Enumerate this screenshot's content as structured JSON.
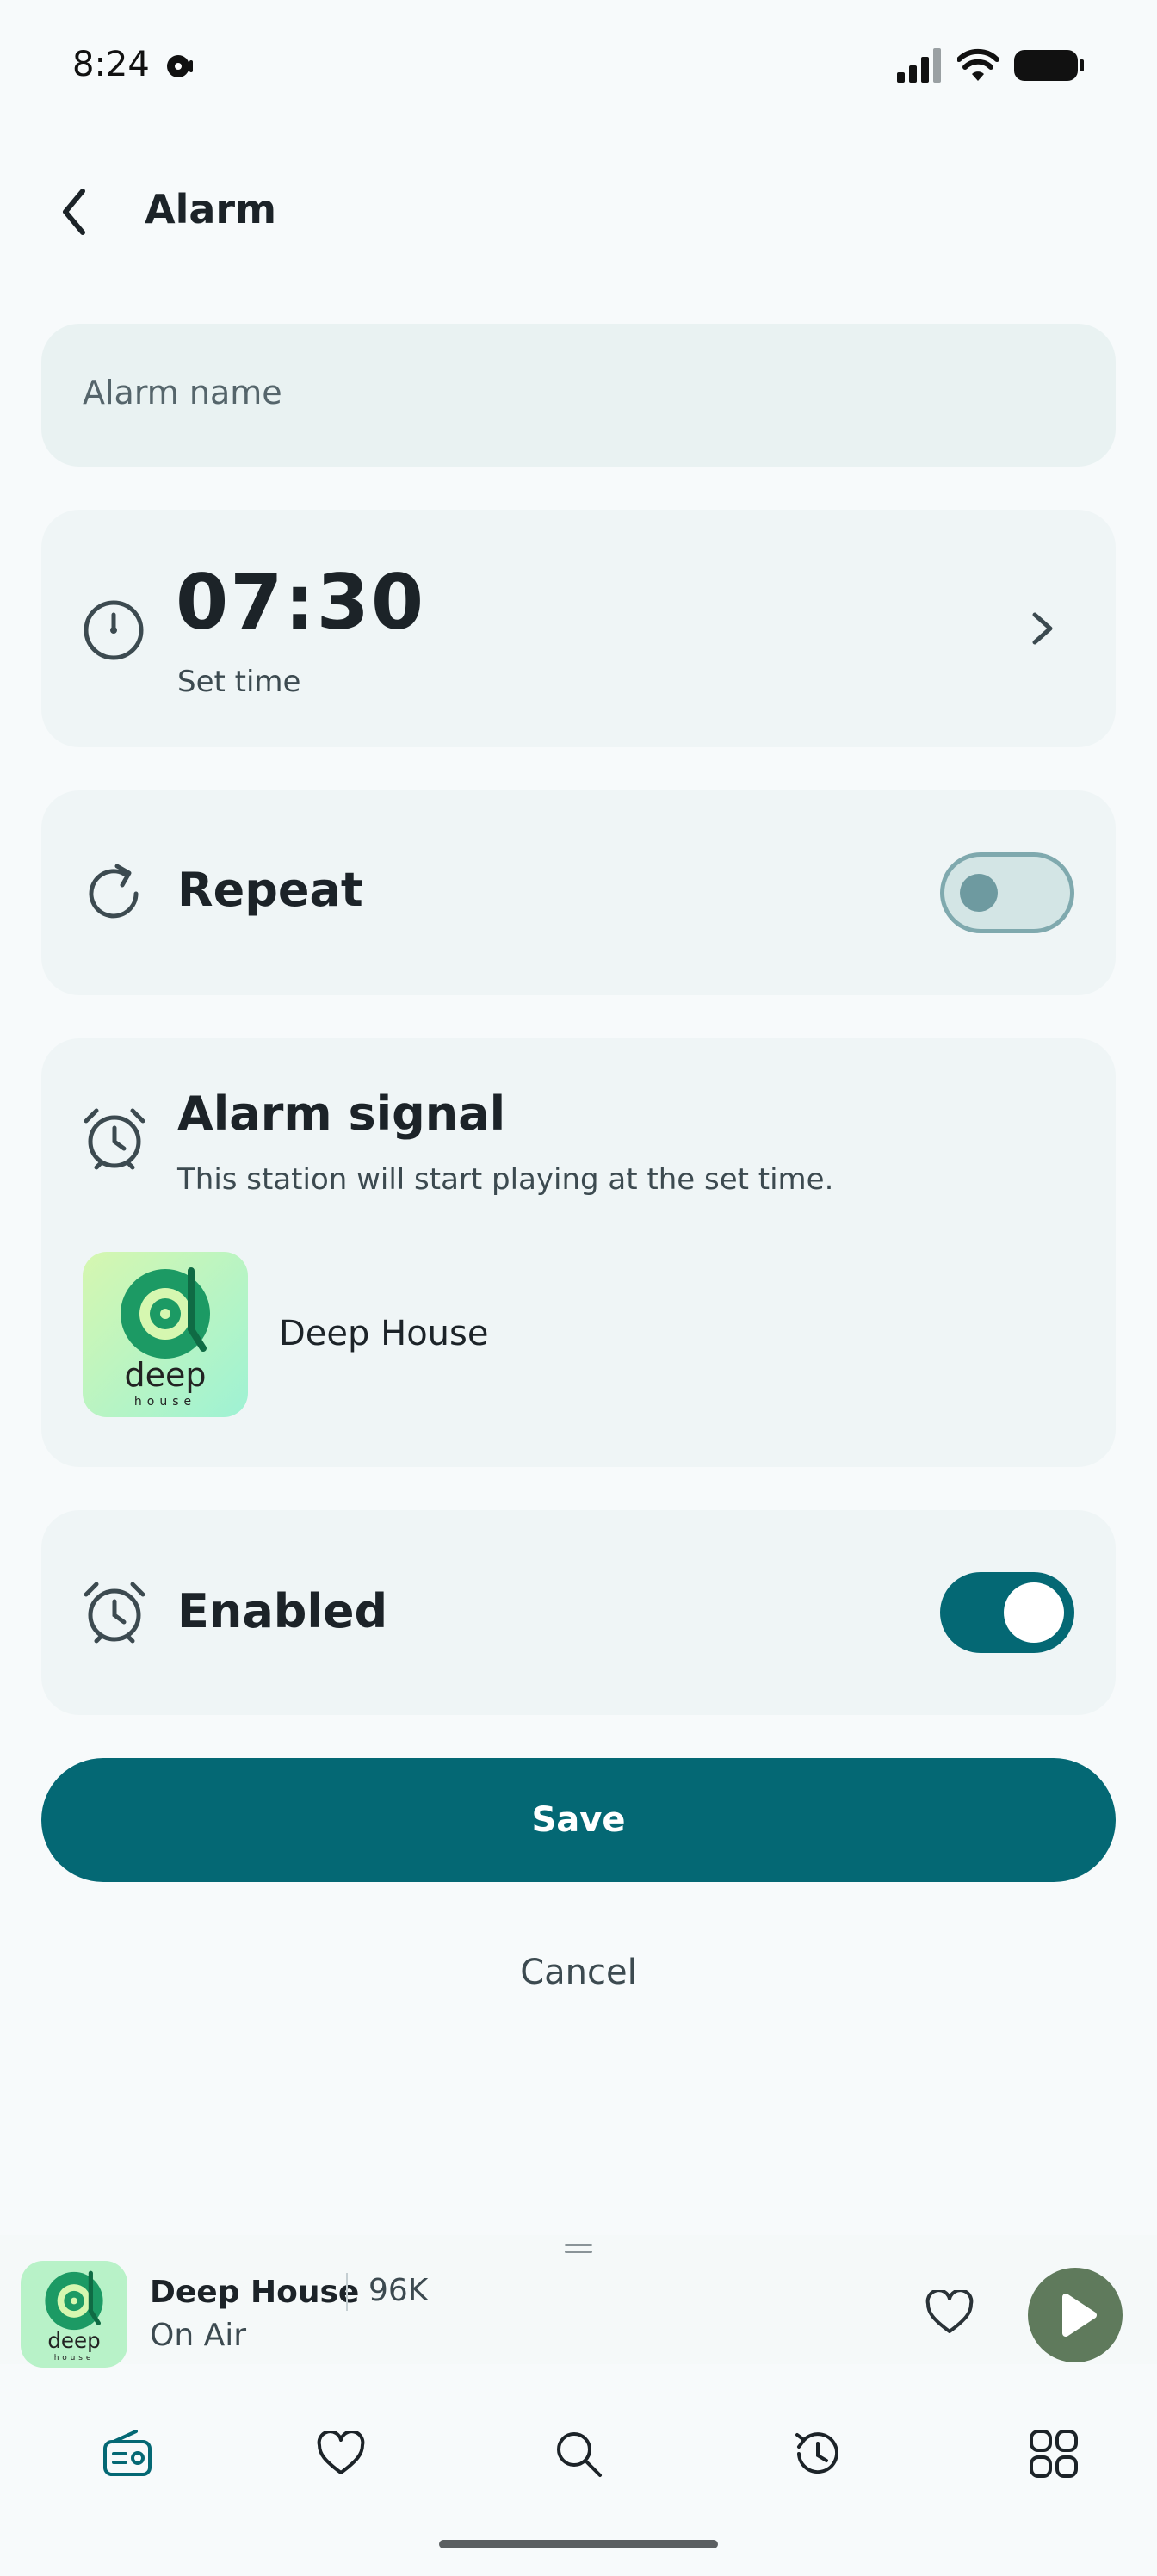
{
  "status_bar": {
    "time": "8:24"
  },
  "header": {
    "title": "Alarm"
  },
  "form": {
    "alarm_name_placeholder": "Alarm name",
    "time": {
      "value": "07:30",
      "label": "Set time"
    },
    "repeat": {
      "label": "Repeat",
      "on": false
    },
    "signal": {
      "title": "Alarm signal",
      "description": "This station will start playing at the set time.",
      "station": "Deep House",
      "logo_text": "deep",
      "logo_subtext": "house"
    },
    "enabled": {
      "label": "Enabled",
      "on": true
    },
    "save_label": "Save",
    "cancel_label": "Cancel"
  },
  "player": {
    "title": "Deep House",
    "listeners": "96K",
    "status": "On Air"
  },
  "nav": {
    "items": [
      "radio-icon",
      "heart-icon",
      "search-icon",
      "history-icon",
      "grid-icon"
    ]
  },
  "colors": {
    "accent": "#046874",
    "card": "#eff5f6",
    "play": "#5f7a5c"
  }
}
